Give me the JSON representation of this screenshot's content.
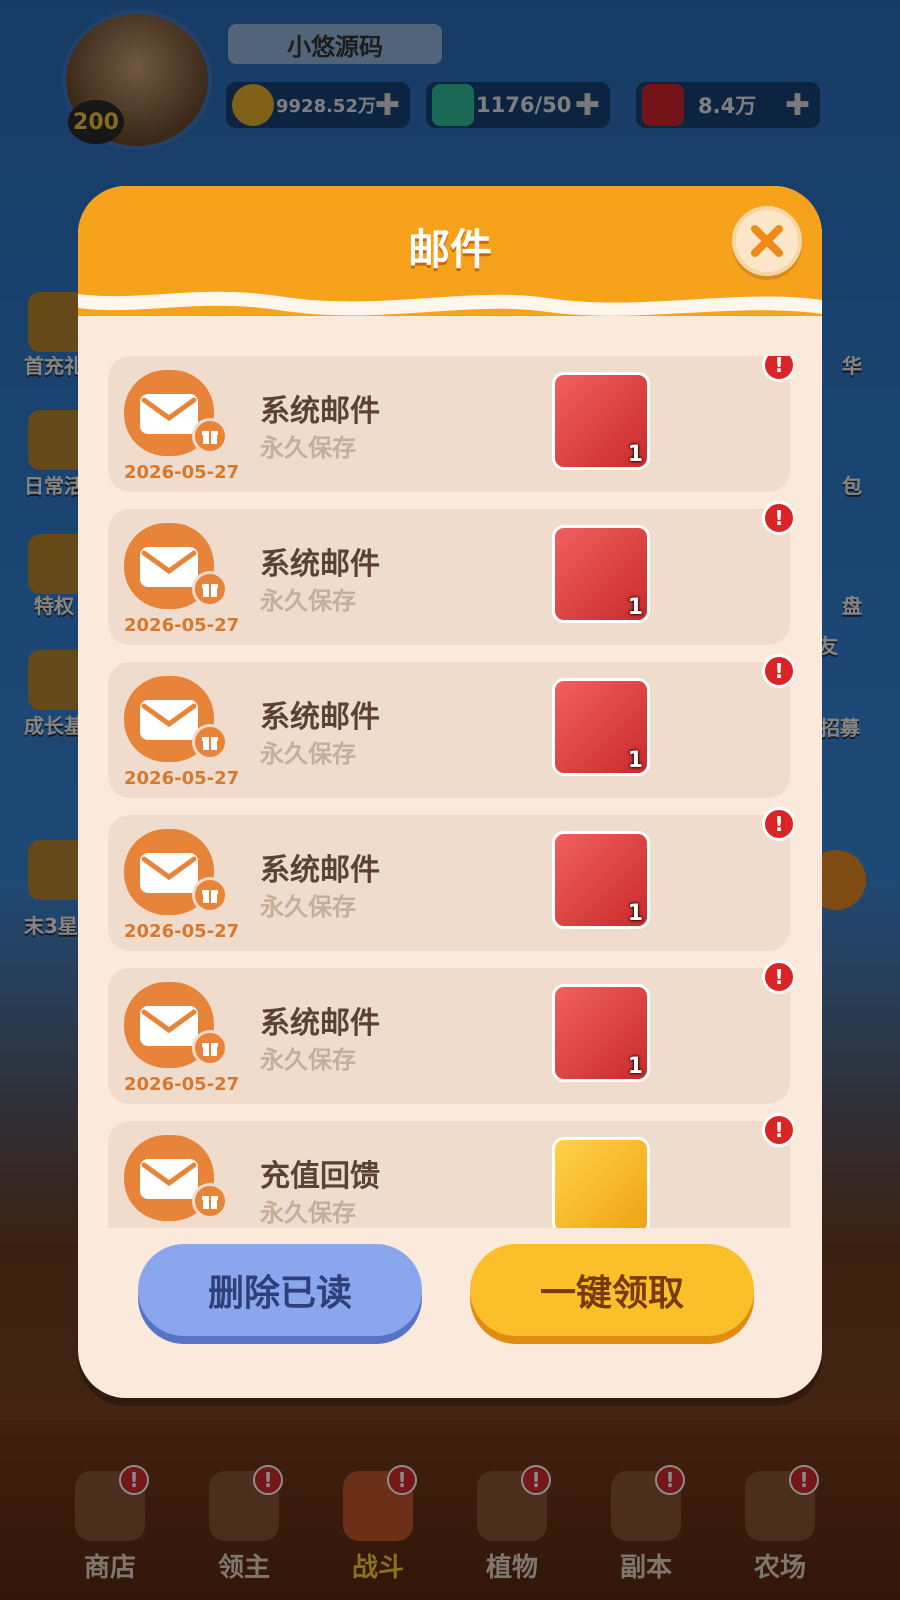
{
  "player": {
    "name": "小悠源码",
    "level": "200"
  },
  "resources": {
    "coins": "9928.52万",
    "energy": "1176/50",
    "gems": "8.4万"
  },
  "side_menu": {
    "left": [
      "首充礼",
      "日常活",
      "特权",
      "成长基",
      "末3星"
    ],
    "right": [
      "华",
      "包",
      "盘",
      "友",
      "物招募"
    ]
  },
  "mail_modal": {
    "title": "邮件",
    "items": [
      {
        "title": "系统邮件",
        "subtitle": "永久保存",
        "date": "2026-05-27",
        "reward_qty": "1",
        "reward_icon": "red-armor-icon",
        "alert": "!"
      },
      {
        "title": "系统邮件",
        "subtitle": "永久保存",
        "date": "2026-05-27",
        "reward_qty": "1",
        "reward_icon": "red-sword-icon",
        "alert": "!"
      },
      {
        "title": "系统邮件",
        "subtitle": "永久保存",
        "date": "2026-05-27",
        "reward_qty": "1",
        "reward_icon": "red-boots-icon",
        "alert": "!"
      },
      {
        "title": "系统邮件",
        "subtitle": "永久保存",
        "date": "2026-05-27",
        "reward_qty": "1",
        "reward_icon": "red-chestplate-icon",
        "alert": "!"
      },
      {
        "title": "系统邮件",
        "subtitle": "永久保存",
        "date": "2026-05-27",
        "reward_qty": "1",
        "reward_icon": "red-helmet-icon",
        "alert": "!"
      },
      {
        "title": "充值回馈",
        "subtitle": "永久保存",
        "date": "",
        "reward_qty": "",
        "reward_icon": "red-gem-icon",
        "alert": "!"
      }
    ],
    "delete_label": "删除已读",
    "claim_label": "一键领取"
  },
  "bottom_nav": [
    {
      "label": "商店",
      "badge": "!"
    },
    {
      "label": "领主",
      "badge": "!"
    },
    {
      "label": "战斗",
      "badge": "!",
      "active": true
    },
    {
      "label": "植物",
      "badge": "!"
    },
    {
      "label": "副本",
      "badge": "!"
    },
    {
      "label": "农场",
      "badge": "!"
    }
  ],
  "colors": {
    "modal_bg": "#fbeadc",
    "header_orange": "#f7a21b",
    "mail_card": "#efdccc",
    "alert_red": "#d92525",
    "delete_blue": "#8aa7ee",
    "claim_yellow": "#fbbf2a"
  }
}
